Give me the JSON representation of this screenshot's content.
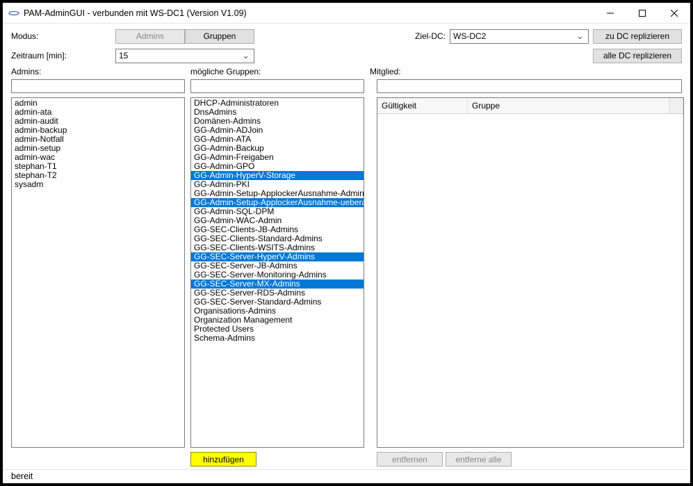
{
  "title": "PAM-AdminGUI - verbunden mit WS-DC1 (Version V1.09)",
  "toolbar": {
    "modus_label": "Modus:",
    "admins_btn": "Admins",
    "gruppen_btn": "Gruppen",
    "zieldc_label": "Ziel-DC:",
    "zieldc_value": "WS-DC2",
    "zu_dc_btn": "zu DC replizieren",
    "alle_dc_btn": "alle DC replizieren",
    "zeitraum_label": "Zeitraum [min]:",
    "zeitraum_value": "15"
  },
  "sections": {
    "admins_label": "Admins:",
    "gruppen_label": "mögliche Gruppen:",
    "mitglied_label": "Mitglied:"
  },
  "filters": {
    "admins": "",
    "gruppen": "",
    "mitglied": ""
  },
  "admins": [
    "admin",
    "admin-ata",
    "admin-audit",
    "admin-backup",
    "admin-Notfall",
    "admin-setup",
    "admin-wac",
    "stephan-T1",
    "stephan-T2",
    "sysadm"
  ],
  "groups": [
    {
      "t": "DHCP-Administratoren",
      "s": false
    },
    {
      "t": "DnsAdmins",
      "s": false
    },
    {
      "t": "Domänen-Admins",
      "s": false
    },
    {
      "t": "GG-Admin-ADJoin",
      "s": false
    },
    {
      "t": "GG-Admin-ATA",
      "s": false
    },
    {
      "t": "GG-Admin-Backup",
      "s": false
    },
    {
      "t": "GG-Admin-Freigaben",
      "s": false
    },
    {
      "t": "GG-Admin-GPO",
      "s": false
    },
    {
      "t": "GG-Admin-HyperV-Storage",
      "s": true
    },
    {
      "t": "GG-Admin-PKI",
      "s": false
    },
    {
      "t": "GG-Admin-Setup-ApplockerAusnahme-AdminDir",
      "s": false
    },
    {
      "t": "GG-Admin-Setup-ApplockerAusnahme-ueberall",
      "s": true
    },
    {
      "t": "GG-Admin-SQL-DPM",
      "s": false
    },
    {
      "t": "GG-Admin-WAC-Admin",
      "s": false
    },
    {
      "t": "GG-SEC-Clients-JB-Admins",
      "s": false
    },
    {
      "t": "GG-SEC-Clients-Standard-Admins",
      "s": false
    },
    {
      "t": "GG-SEC-Clients-WSITS-Admins",
      "s": false
    },
    {
      "t": "GG-SEC-Server-HyperV-Admins",
      "s": true
    },
    {
      "t": "GG-SEC-Server-JB-Admins",
      "s": false
    },
    {
      "t": "GG-SEC-Server-Monitoring-Admins",
      "s": false
    },
    {
      "t": "GG-SEC-Server-MX-Admins",
      "s": true
    },
    {
      "t": "GG-SEC-Server-RDS-Admins",
      "s": false
    },
    {
      "t": "GG-SEC-Server-Standard-Admins",
      "s": false
    },
    {
      "t": "Organisations-Admins",
      "s": false
    },
    {
      "t": "Organization Management",
      "s": false
    },
    {
      "t": "Protected Users",
      "s": false
    },
    {
      "t": "Schema-Admins",
      "s": false
    }
  ],
  "grid": {
    "col_gueltigkeit": "Gültigkeit",
    "col_gruppe": "Gruppe"
  },
  "buttons": {
    "hinzufuegen": "hinzufügen",
    "entfernen": "entfernen",
    "entferne_alle": "entferne alle"
  },
  "status": "bereit"
}
